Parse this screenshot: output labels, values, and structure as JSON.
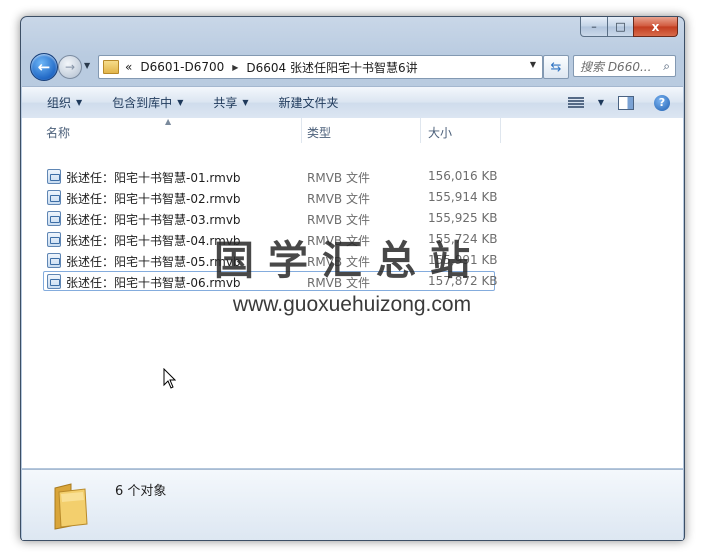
{
  "window": {
    "caption_buttons": {
      "minimize": "–",
      "maximize": "□",
      "close": "x"
    }
  },
  "nav": {
    "back_icon": "←",
    "forward_icon": "→"
  },
  "address": {
    "chevron": "«",
    "segments": [
      "D6601-D6700",
      "D6604 张述任阳宅十书智慧6讲"
    ]
  },
  "search": {
    "placeholder": "搜索 D660..."
  },
  "toolbar": {
    "organize": "组织",
    "include_in_library": "包含到库中",
    "share": "共享",
    "new_folder": "新建文件夹"
  },
  "columns": {
    "name": "名称",
    "type": "类型",
    "size": "大小"
  },
  "files": [
    {
      "name": "张述任：阳宅十书智慧-01.rmvb",
      "type": "RMVB 文件",
      "size": "156,016 KB"
    },
    {
      "name": "张述任：阳宅十书智慧-02.rmvb",
      "type": "RMVB 文件",
      "size": "155,914 KB"
    },
    {
      "name": "张述任：阳宅十书智慧-03.rmvb",
      "type": "RMVB 文件",
      "size": "155,925 KB"
    },
    {
      "name": "张述任：阳宅十书智慧-04.rmvb",
      "type": "RMVB 文件",
      "size": "155,724 KB"
    },
    {
      "name": "张述任：阳宅十书智慧-05.rmvb",
      "type": "RMVB 文件",
      "size": "155,991 KB"
    },
    {
      "name": "张述任：阳宅十书智慧-06.rmvb",
      "type": "RMVB 文件",
      "size": "157,872 KB"
    }
  ],
  "watermark": {
    "text": "国学汇总站",
    "url": "www.guoxuehuizong.com"
  },
  "status": {
    "count": "6 个对象"
  },
  "colors": {
    "accent": "#1e395b",
    "selection_border": "#84acdd"
  }
}
